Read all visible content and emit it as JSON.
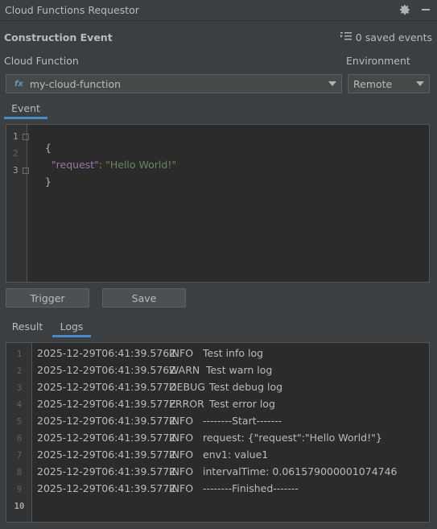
{
  "window": {
    "title": "Cloud Functions Requestor"
  },
  "header": {
    "title": "Construction Event",
    "saved_events": "0 saved events"
  },
  "form": {
    "function_label": "Cloud Function",
    "function_value": "my-cloud-function",
    "function_badge": "fx",
    "environment_label": "Environment",
    "environment_value": "Remote"
  },
  "editor_tabs": [
    {
      "label": "Event",
      "active": true
    }
  ],
  "editor": {
    "line_numbers": [
      "1",
      "2",
      "3"
    ],
    "open_brace": "{",
    "key": "\"request\"",
    "colon": ": ",
    "value": "\"Hello World!\"",
    "close_brace": "}"
  },
  "actions": {
    "trigger_label": "Trigger",
    "save_label": "Save"
  },
  "result_tabs": [
    {
      "label": "Result",
      "active": false
    },
    {
      "label": "Logs",
      "active": true
    }
  ],
  "logs": [
    {
      "n": "1",
      "ts": "2025-12-29T06:41:39.576Z",
      "level": "INFO",
      "msg": "Test info log"
    },
    {
      "n": "2",
      "ts": "2025-12-29T06:41:39.576Z",
      "level": "WARN",
      "msg": " Test warn log"
    },
    {
      "n": "3",
      "ts": "2025-12-29T06:41:39.577Z",
      "level": "DEBUG",
      "msg": "Test debug log"
    },
    {
      "n": "4",
      "ts": "2025-12-29T06:41:39.577Z",
      "level": "ERROR",
      "msg": "Test error log"
    },
    {
      "n": "5",
      "ts": "2025-12-29T06:41:39.577Z",
      "level": "INFO",
      "msg": "--------Start-------"
    },
    {
      "n": "6",
      "ts": "2025-12-29T06:41:39.577Z",
      "level": "INFO",
      "msg": "request: {\"request\":\"Hello World!\"}"
    },
    {
      "n": "7",
      "ts": "2025-12-29T06:41:39.577Z",
      "level": "INFO",
      "msg": "env1: value1"
    },
    {
      "n": "8",
      "ts": "2025-12-29T06:41:39.577Z",
      "level": "INFO",
      "msg": "intervalTime: 0.061579000001074746"
    },
    {
      "n": "9",
      "ts": "2025-12-29T06:41:39.577Z",
      "level": "INFO",
      "msg": "--------Finished-------"
    }
  ],
  "log_last_line": "10",
  "icons": {
    "settings": "gear-icon",
    "minimize": "minimize-icon",
    "saved": "list-icon",
    "dropdown": "chevron-down-icon"
  },
  "colors": {
    "accent": "#4a88c7",
    "json_key": "#9876aa",
    "json_string": "#6a8759"
  }
}
